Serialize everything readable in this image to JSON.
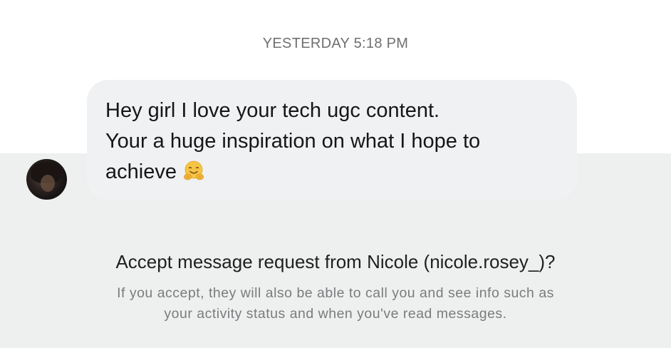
{
  "conversation": {
    "timestamp": "YESTERDAY 5:18 PM",
    "message": {
      "line1": "Hey girl I love your tech ugc content.",
      "line2": "Your a huge inspiration on what I hope to",
      "line3": "achieve",
      "emoji": "hugging-face-icon"
    },
    "sender_avatar": "avatar"
  },
  "request": {
    "title": "Accept message request from Nicole (nicole.rosey_)?",
    "description_line1": "If you accept, they will also be able to call you and see info such as",
    "description_line2": "your activity status and when you've read messages."
  },
  "colors": {
    "panel_background": "#eef0ef",
    "bubble_background": "#f0f1f3",
    "timestamp_text": "#6f6f72",
    "description_text": "#7b7b7e",
    "emoji_yellow": "#f6c443"
  }
}
